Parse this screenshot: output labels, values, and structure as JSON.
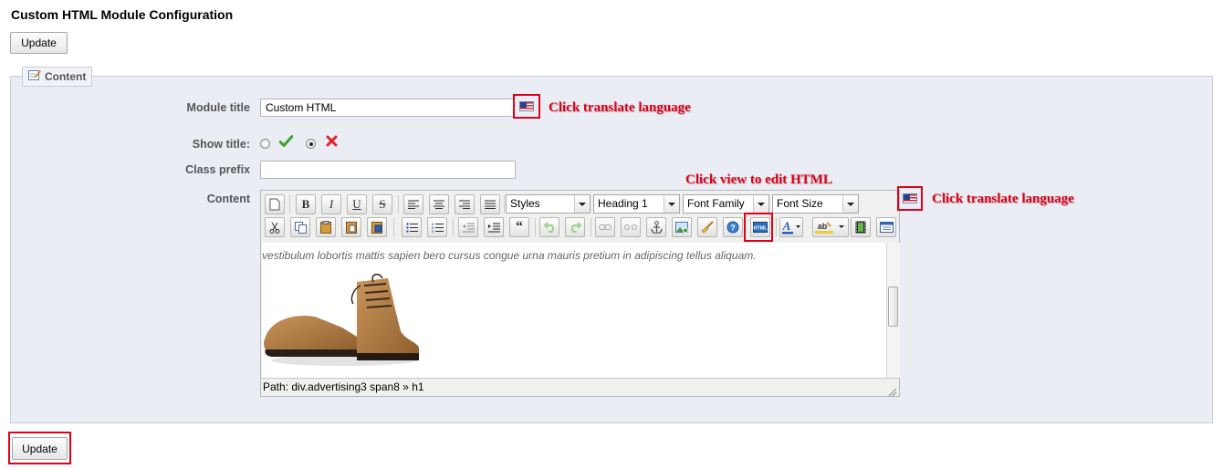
{
  "page": {
    "title": "Custom HTML Module Configuration",
    "update_label": "Update"
  },
  "panel": {
    "legend": "Content"
  },
  "form": {
    "module_title_label": "Module title",
    "module_title_value": "Custom HTML",
    "show_title_label": "Show title:",
    "show_title_selected": "no",
    "class_prefix_label": "Class prefix",
    "class_prefix_value": "",
    "content_label": "Content"
  },
  "editor": {
    "styles_select": "Styles",
    "format_select": "Heading 1",
    "font_family_select": "Font Family",
    "font_size_select": "Font Size",
    "body_text": "vestibulum lobortis mattis sapien bero cursus congue urna mauris pretium in adipiscing tellus aliquam.",
    "path_text": "Path: div.advertising3 span8 » h1",
    "toolbar_row1": [
      "new-document-icon",
      "bold-icon",
      "italic-icon",
      "underline-icon",
      "strikethrough-icon",
      "align-left-icon",
      "align-center-icon",
      "align-right-icon",
      "align-justify-icon"
    ],
    "toolbar_row2": [
      "cut-icon",
      "copy-icon",
      "paste-icon",
      "paste-text-icon",
      "paste-word-icon",
      "bullet-list-icon",
      "numbered-list-icon",
      "outdent-icon",
      "indent-icon",
      "blockquote-icon",
      "undo-icon",
      "redo-icon",
      "link-icon",
      "unlink-icon",
      "anchor-icon",
      "image-icon",
      "cleanup-icon",
      "help-icon",
      "html-source-icon",
      "text-color-icon",
      "background-color-icon",
      "media-icon",
      "template-icon"
    ]
  },
  "annotations": {
    "translate_label": "Click translate language",
    "html_label": "Click view to edit HTML"
  },
  "colors": {
    "annotation_red": "#e0001a",
    "panel_bg": "#ebedf4",
    "check_green": "#3da42a",
    "cross_red": "#e2232a"
  }
}
